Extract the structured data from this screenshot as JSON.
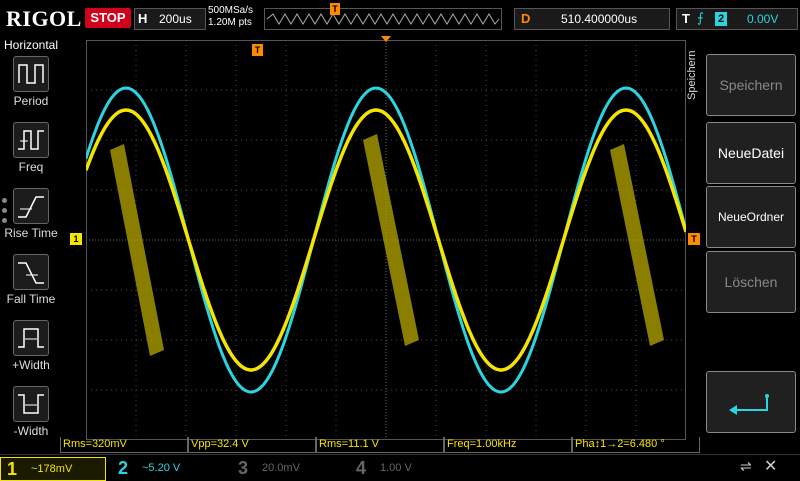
{
  "header": {
    "brand": "RIGOL",
    "run_state": "STOP",
    "horizontal_key": "H",
    "timebase": "200us",
    "sample_rate": "500MSa/s",
    "memory_depth": "1.20M pts",
    "delay_key": "D",
    "delay_value": "510.400000us",
    "trigger_key": "T",
    "trigger_edge": "rising-edge-icon",
    "trigger_channel": "2",
    "trigger_level": "0.00V",
    "trigger_marker": "T"
  },
  "left_panel": {
    "title": "Horizontal",
    "items": [
      {
        "label": "Period",
        "icon": "period-icon"
      },
      {
        "label": "Freq",
        "icon": "frequency-icon"
      },
      {
        "label": "Rise Time",
        "icon": "rise-time-icon"
      },
      {
        "label": "Fall Time",
        "icon": "fall-time-icon"
      },
      {
        "label": "+Width",
        "icon": "positive-width-icon"
      },
      {
        "label": "-Width",
        "icon": "negative-width-icon"
      }
    ]
  },
  "right_panel": {
    "title": "Speichern",
    "buttons": [
      {
        "label": "Speichern",
        "enabled": false
      },
      {
        "label": "NeueDatei",
        "enabled": true
      },
      {
        "label": "NeueOrdner",
        "enabled": true
      },
      {
        "label": "Löschen",
        "enabled": false
      }
    ],
    "back_icon": "return-arrow-icon"
  },
  "markers": {
    "ch1_ground": "1",
    "trigger_level_marker": "T"
  },
  "measurements": [
    {
      "label": "Rms=320mV"
    },
    {
      "label": "Vpp=32.4 V"
    },
    {
      "label": "Rms=11.1 V"
    },
    {
      "label": "Freq=1.00kHz"
    },
    {
      "label": "Pha↕1→2=6.480 °"
    }
  ],
  "channels": [
    {
      "num": "1",
      "value": "~178mV",
      "color": "#f5e400",
      "active": true
    },
    {
      "num": "2",
      "value": "~5.20 V",
      "color": "#2ad4e0",
      "active": true
    },
    {
      "num": "3",
      "value": "20.0mV",
      "color": "#666666",
      "active": false
    },
    {
      "num": "4",
      "value": "1.00 V",
      "color": "#666666",
      "active": false
    }
  ],
  "status_icons": [
    "usb-icon",
    "sound-off-icon"
  ],
  "colors": {
    "ch1": "#f5e400",
    "ch2": "#2ad4e0",
    "trigger": "#ff8a00",
    "stop": "#d0021b"
  }
}
